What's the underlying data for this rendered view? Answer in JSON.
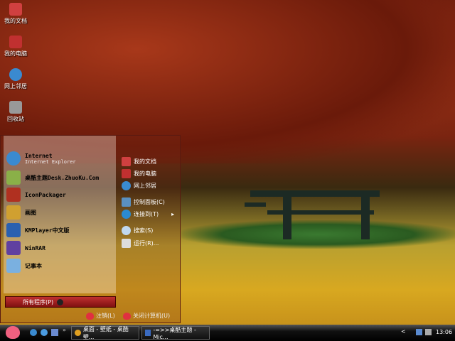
{
  "desktop_icons": [
    {
      "label": "我的文档"
    },
    {
      "label": "我的电脑"
    },
    {
      "label": "网上邻居"
    },
    {
      "label": "回收站"
    }
  ],
  "start_menu": {
    "pinned": [
      {
        "label": "Internet",
        "sub": "Internet Explorer"
      },
      {
        "label": "桌酷主题Desk.ZhuoKu.Com"
      },
      {
        "label": "IconPackager"
      },
      {
        "label": "画图"
      },
      {
        "label": "KMPlayer中文版"
      },
      {
        "label": "WinRAR"
      },
      {
        "label": "记事本"
      }
    ],
    "all_programs": "所有程序(P)",
    "right": [
      {
        "label": "我的文档"
      },
      {
        "label": "我的电脑"
      },
      {
        "label": "网上邻居"
      },
      {
        "label": "控制面板(C)"
      },
      {
        "label": "连接到(T)"
      },
      {
        "label": "搜索(S)"
      },
      {
        "label": "运行(R)..."
      }
    ],
    "logoff": "注销(L)",
    "shutdown": "关闭计算机(U)"
  },
  "taskbar": {
    "tasks": [
      {
        "label": "桌面 - 壁纸 - 桌酷壁..."
      },
      {
        "label": "-=>>桌酷主题 - Mic..."
      }
    ],
    "clock": "13:06",
    "tray_arrow": "<"
  }
}
